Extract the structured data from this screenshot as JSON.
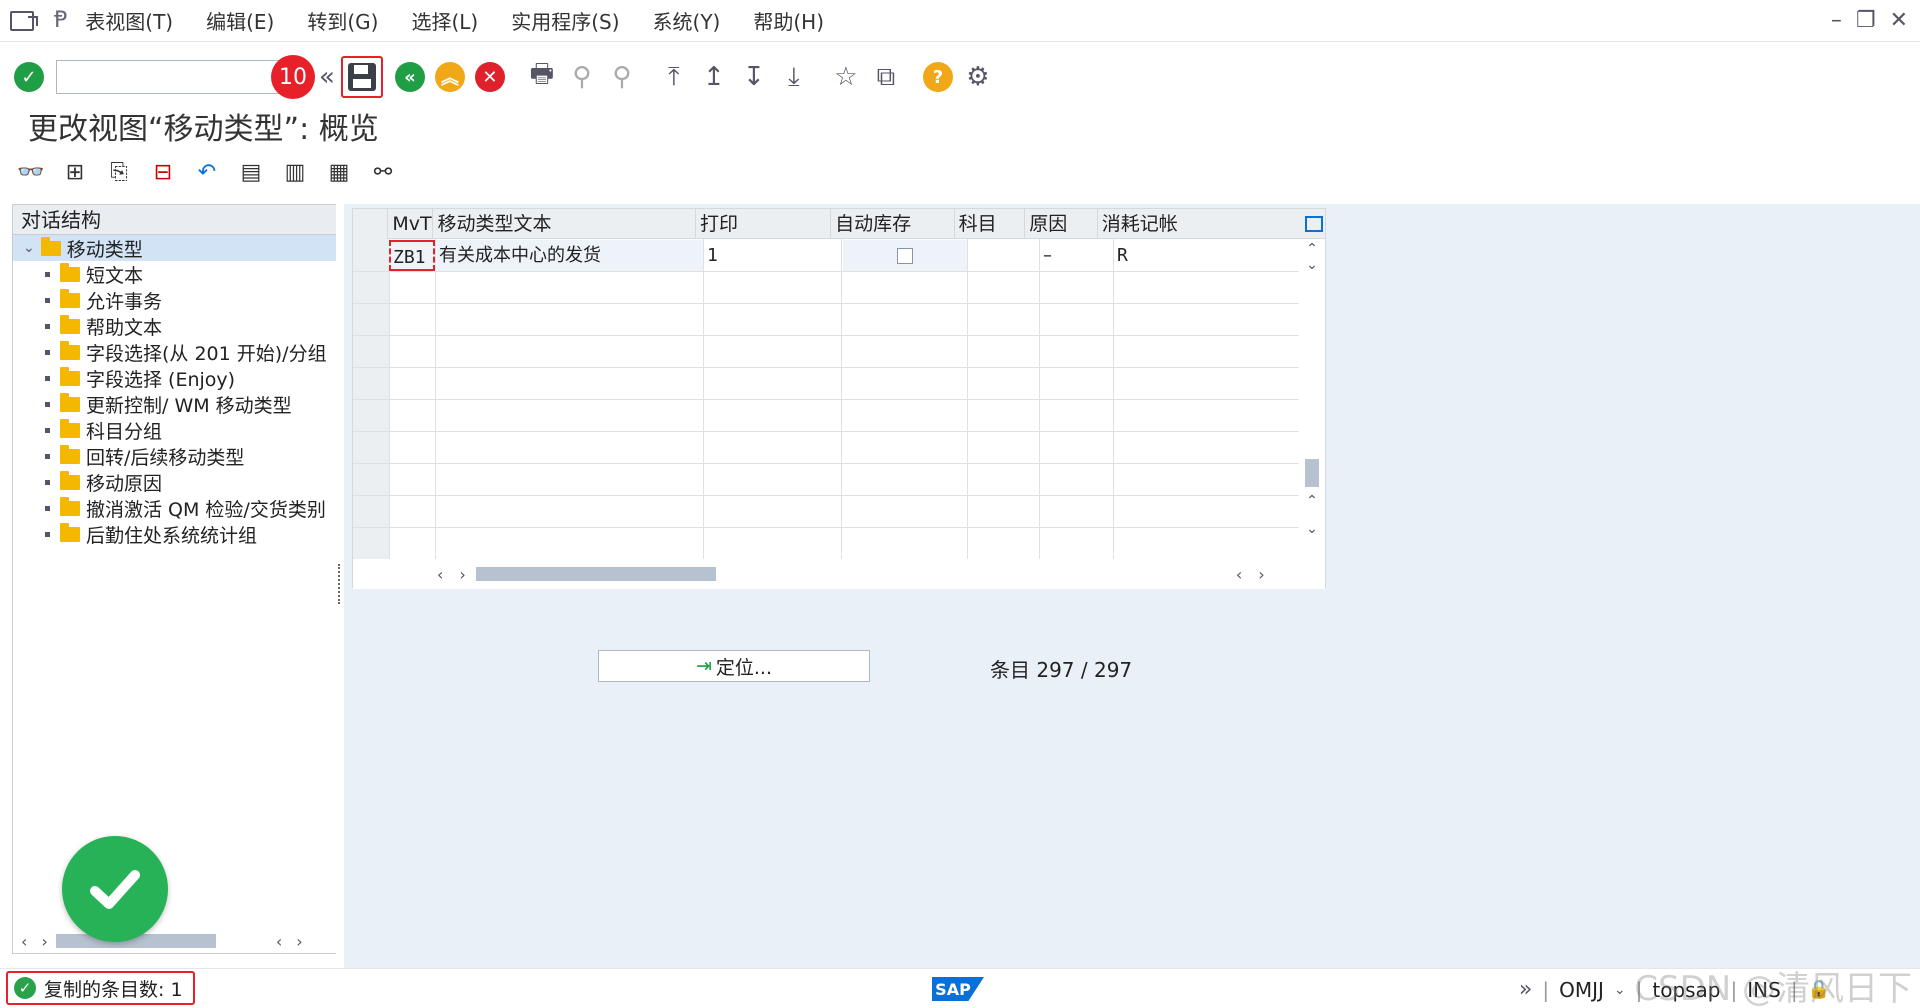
{
  "menu": {
    "items": [
      "表视图(T)",
      "编辑(E)",
      "转到(G)",
      "选择(L)",
      "实用程序(S)",
      "系统(Y)",
      "帮助(H)"
    ]
  },
  "toolbar": {
    "step_badge": "10",
    "back_glyph": "«",
    "help_glyph": "?"
  },
  "page": {
    "title": "更改视图“移动类型”: 概览"
  },
  "tree": {
    "header": "对话结构",
    "root": "移动类型",
    "items": [
      "短文本",
      "允许事务",
      "帮助文本",
      "字段选择(从 201 开始)/分组",
      "字段选择 (Enjoy)",
      "更新控制/ WM 移动类型",
      "科目分组",
      "回转/后续移动类型",
      "移动原因",
      "撤消激活 QM 检验/交货类别",
      "后勤住处系统统计组"
    ]
  },
  "grid": {
    "columns": [
      "MvT",
      "移动类型文本",
      "打印",
      "自动库存",
      "科目",
      "原因",
      "消耗记帐"
    ],
    "rows": [
      {
        "mvt": "ZB1",
        "text": "有关成本中心的发货",
        "print": "1",
        "auto": "",
        "account": "",
        "reason": "–",
        "consumption": "R"
      }
    ]
  },
  "locate_button": "定位...",
  "entry_count": "条目 297 / 297",
  "status": {
    "message": "复制的条目数: 1",
    "sap": "SAP",
    "transaction": "OMJJ",
    "server": "topsap",
    "mode": "INS"
  },
  "watermark": "CSDN @清风日下",
  "colors": {
    "accent_red": "#e8202a",
    "success_green": "#27b258",
    "sap_blue": "#0a6fd6"
  }
}
